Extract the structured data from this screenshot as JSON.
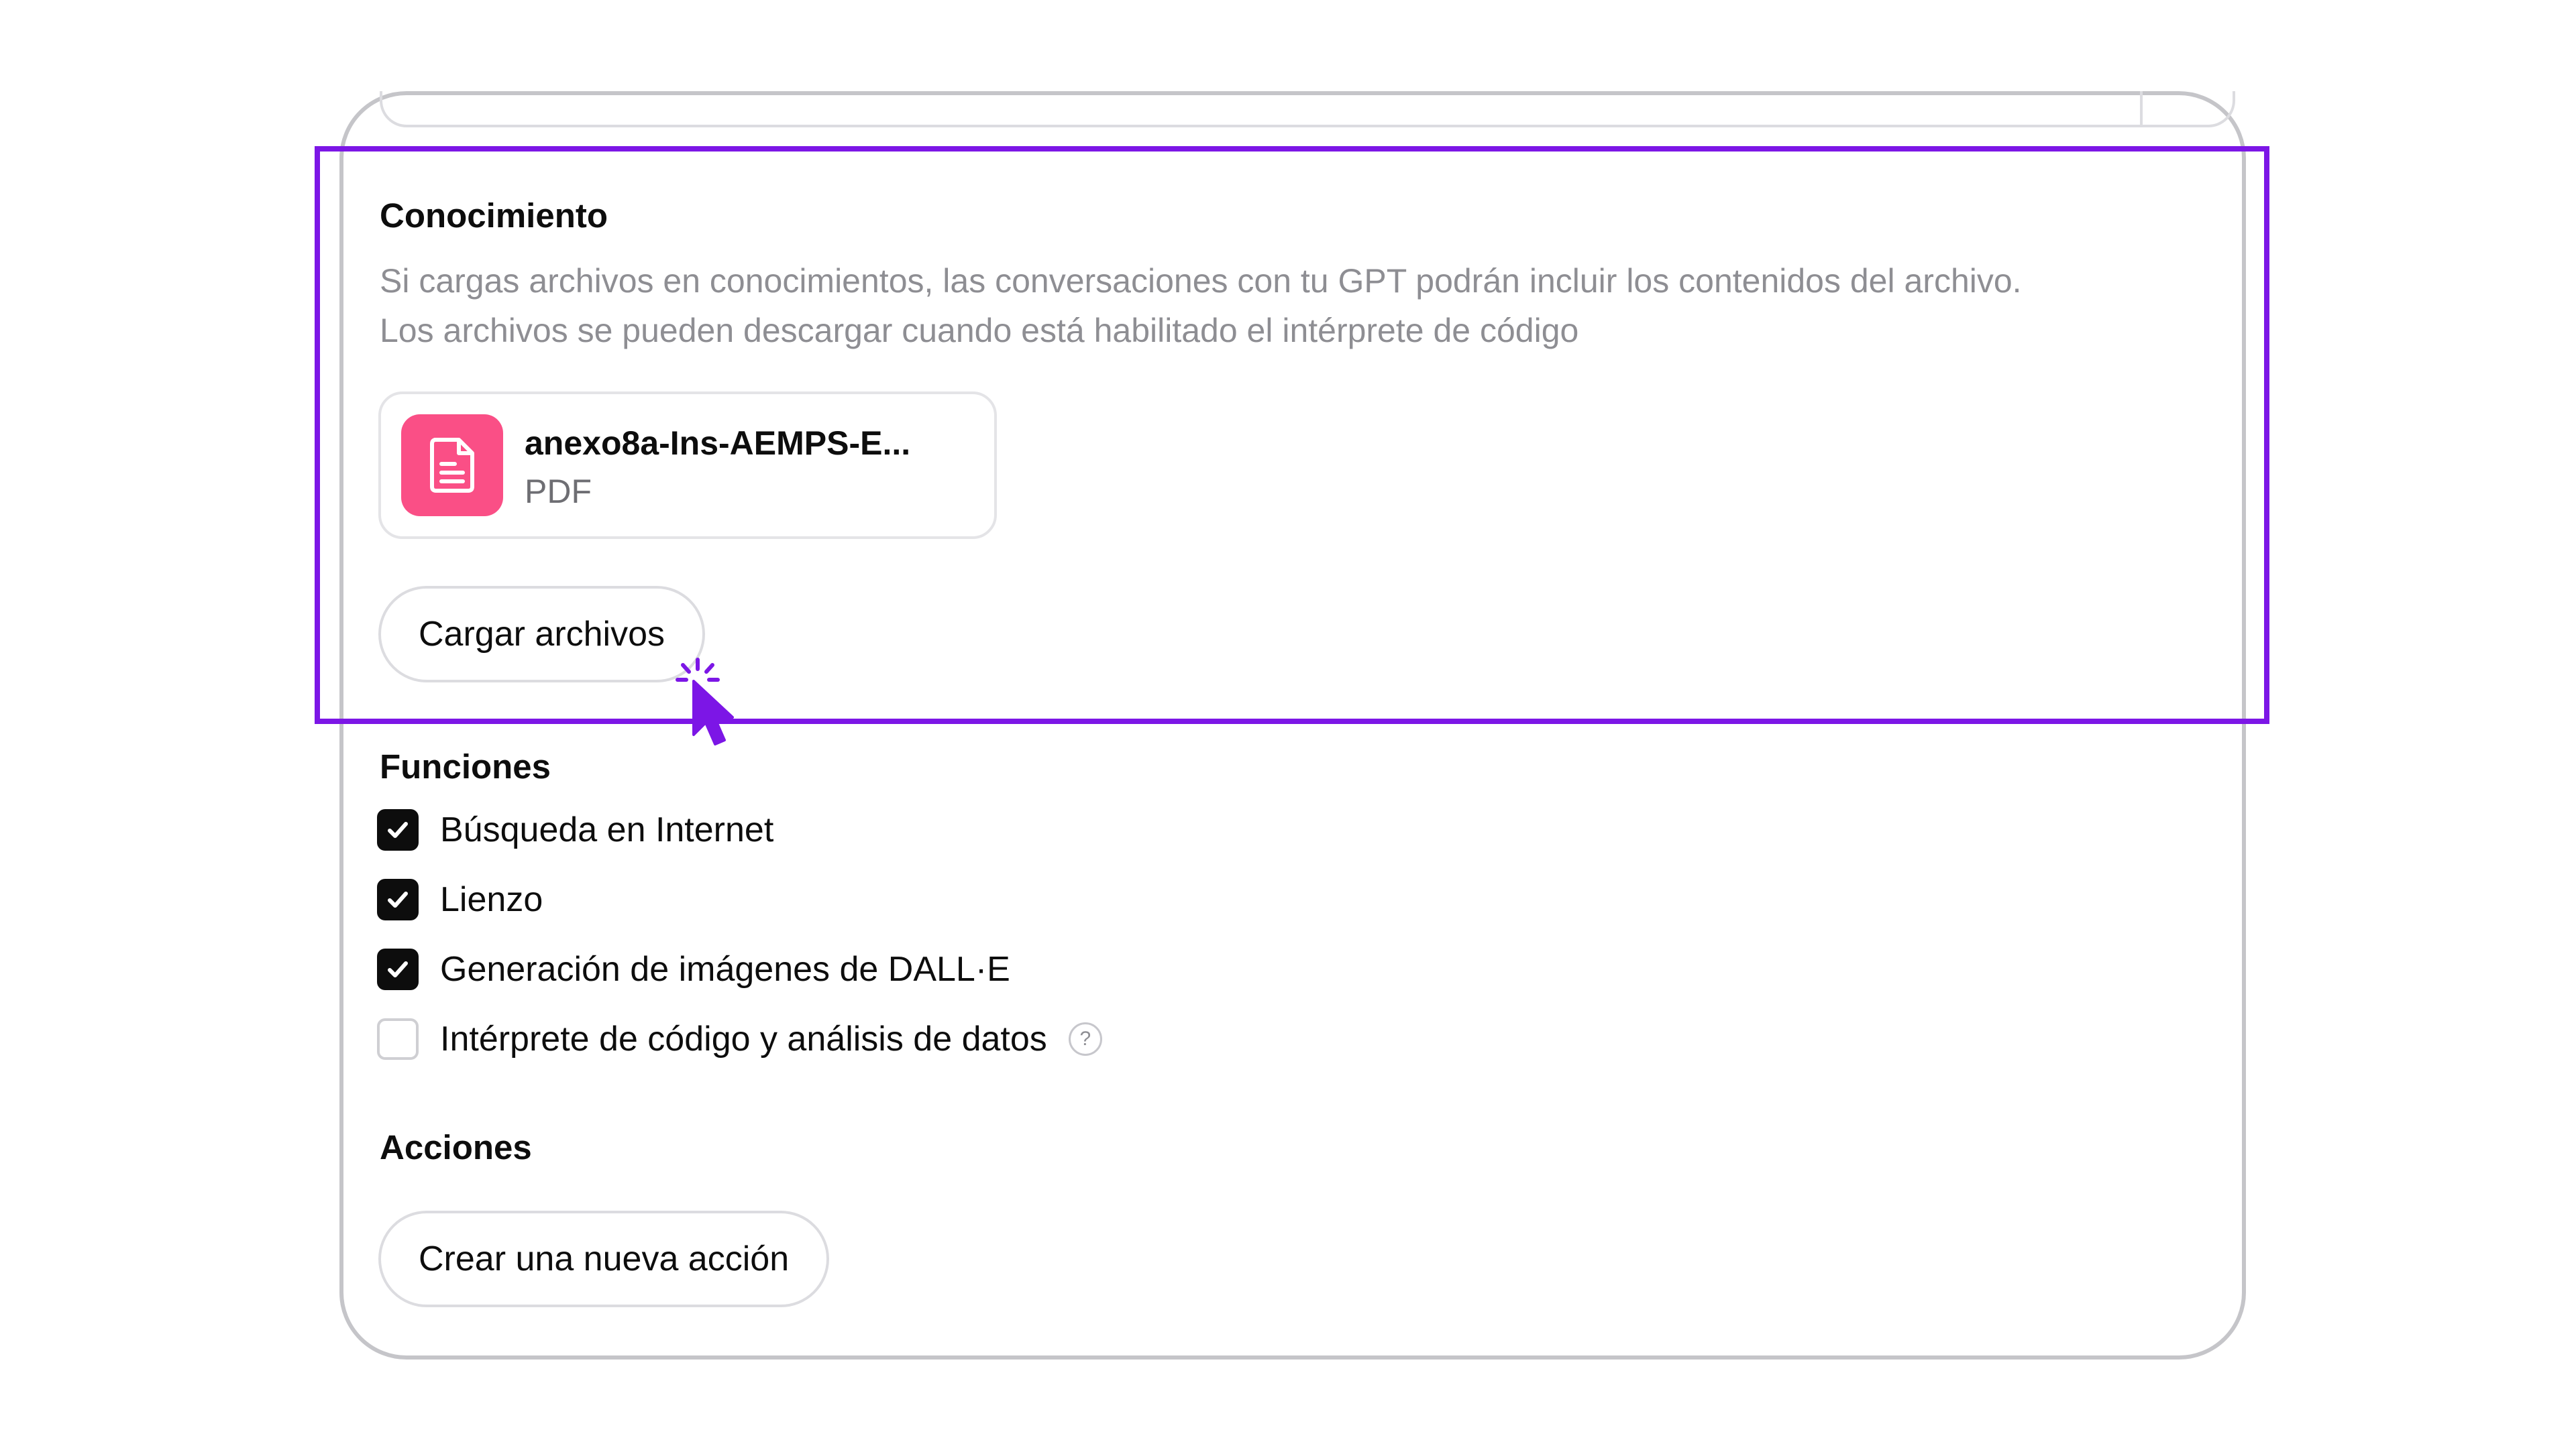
{
  "knowledge": {
    "title": "Conocimiento",
    "description_line1": "Si cargas archivos en conocimientos, las conversaciones con tu GPT podrán incluir los contenidos del archivo.",
    "description_line2": "Los archivos se pueden descargar cuando está habilitado el intérprete de código",
    "file": {
      "name": "anexo8a-Ins-AEMPS-E...",
      "type": "PDF",
      "icon": "document-icon",
      "icon_color": "#fa4f86"
    },
    "upload_button": "Cargar archivos"
  },
  "capabilities": {
    "title": "Funciones",
    "items": [
      {
        "label": "Búsqueda en Internet",
        "checked": true
      },
      {
        "label": "Lienzo",
        "checked": true
      },
      {
        "label": "Generación de imágenes de DALL·E",
        "checked": true
      },
      {
        "label": "Intérprete de código y análisis de datos",
        "checked": false,
        "help": "?"
      }
    ]
  },
  "actions": {
    "title": "Acciones",
    "create_button": "Crear una nueva acción"
  },
  "colors": {
    "highlight": "#7c16e6",
    "cursor": "#7c16e6"
  }
}
